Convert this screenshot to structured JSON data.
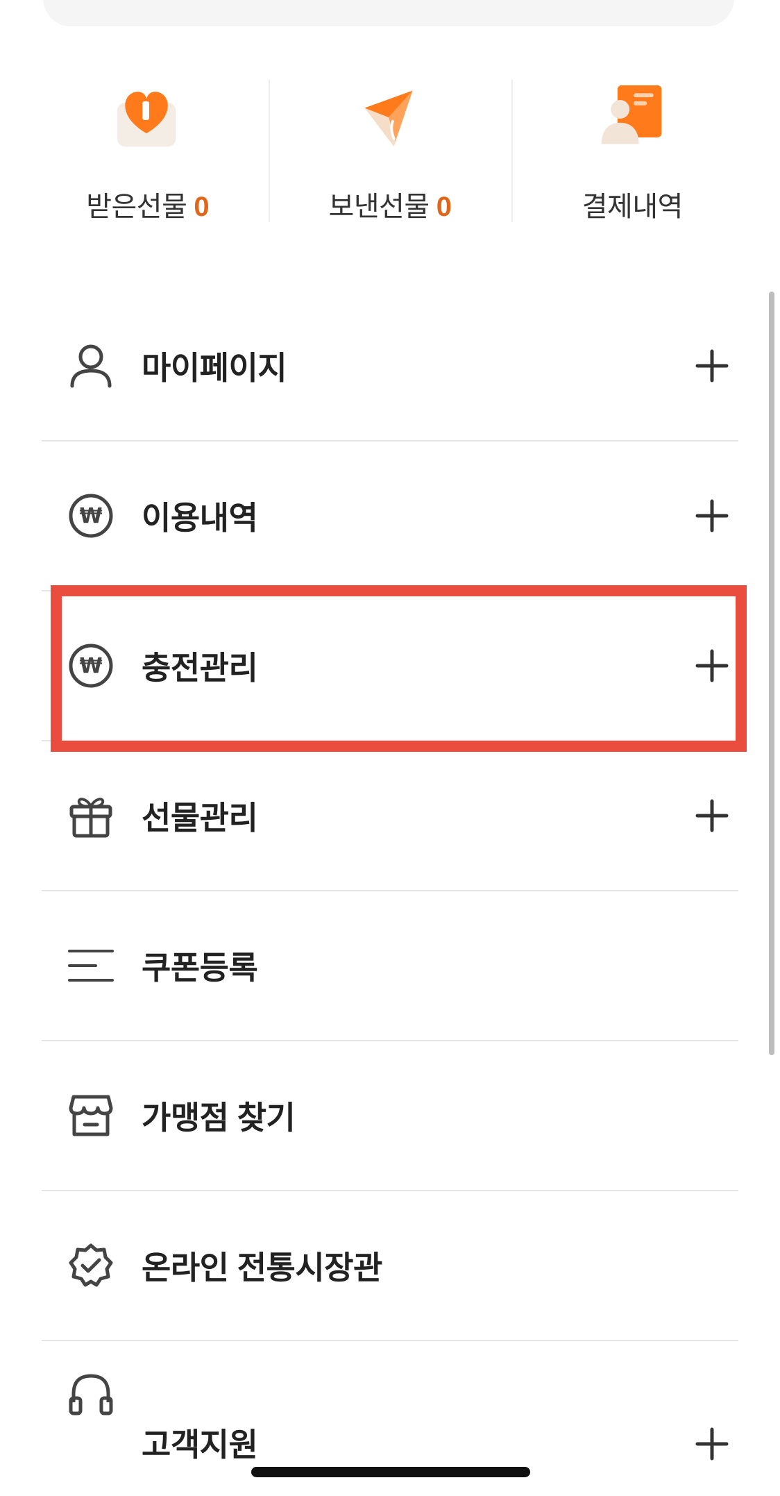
{
  "quick_actions": [
    {
      "label": "받은선물",
      "count": "0",
      "icon": "received-gift-icon"
    },
    {
      "label": "보낸선물",
      "count": "0",
      "icon": "sent-gift-icon"
    },
    {
      "label": "결제내역",
      "count": "",
      "icon": "payment-history-icon"
    }
  ],
  "menu": [
    {
      "label": "마이페이지",
      "icon": "person-icon",
      "expandable": true
    },
    {
      "label": "이용내역",
      "icon": "won-circle-icon",
      "expandable": true
    },
    {
      "label": "충전관리",
      "icon": "won-circle-icon",
      "expandable": true,
      "highlighted": true
    },
    {
      "label": "선물관리",
      "icon": "gift-icon",
      "expandable": true
    },
    {
      "label": "쿠폰등록",
      "icon": "lines-icon",
      "expandable": false
    },
    {
      "label": "가맹점 찾기",
      "icon": "store-icon",
      "expandable": false
    },
    {
      "label": "온라인 전통시장관",
      "icon": "verified-badge-icon",
      "expandable": false
    },
    {
      "label": "고객지원",
      "icon": "headset-icon",
      "expandable": true
    }
  ],
  "colors": {
    "accent": "#e0661a",
    "icon_orange": "#ff7a1a",
    "highlight_border": "#ea4c3e",
    "text": "#222222"
  }
}
